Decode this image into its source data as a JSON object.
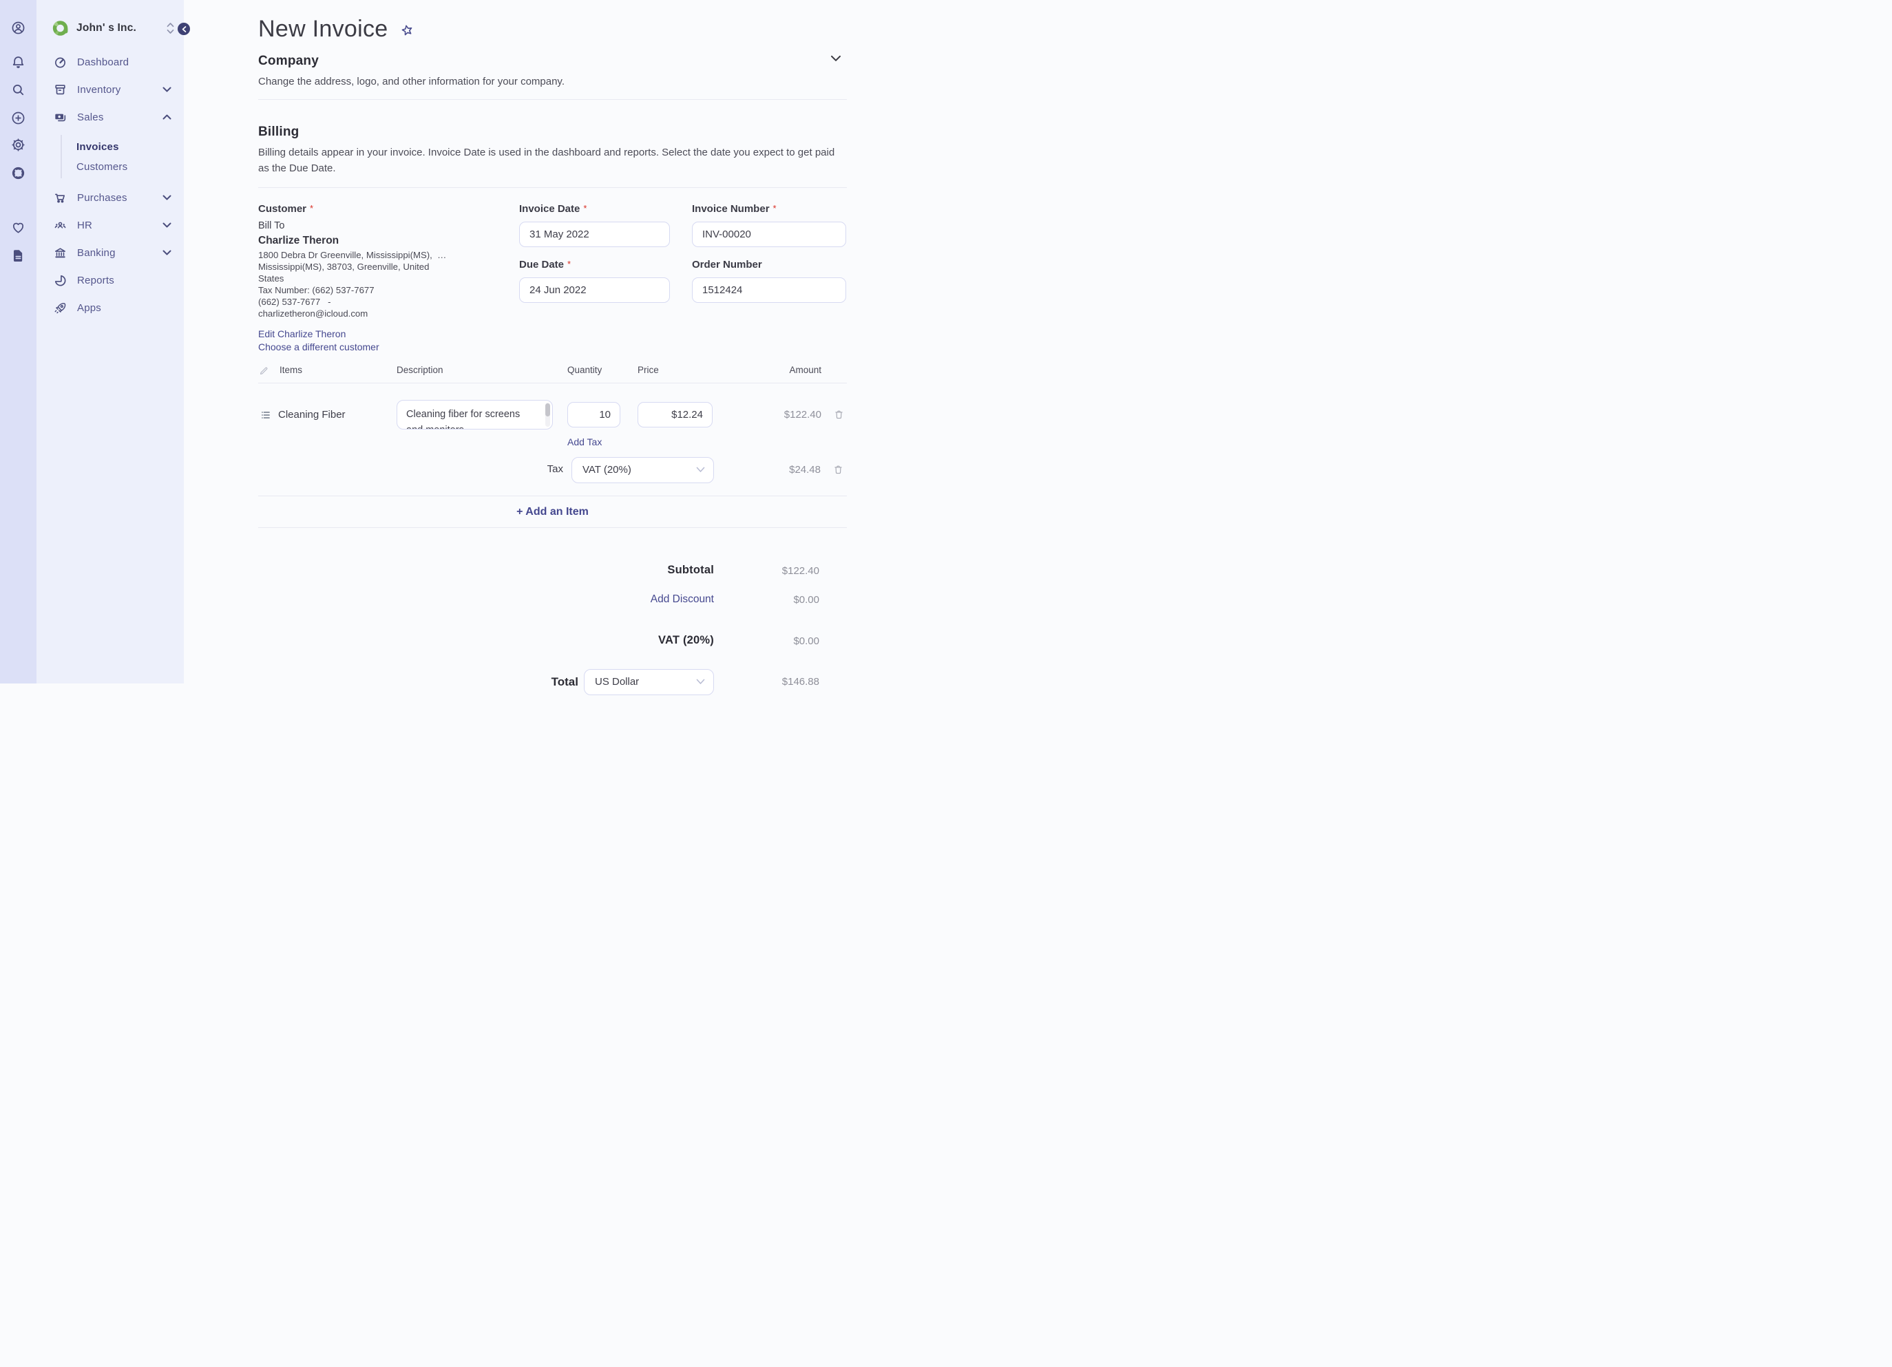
{
  "brand": {
    "company_name": "John' s Inc."
  },
  "icons": {
    "rail": [
      "user-circle",
      "bell",
      "search",
      "plus-circle",
      "gear",
      "life-ring",
      "heart",
      "document"
    ],
    "sidebar": [
      "dashboard-gauge",
      "inventory-box",
      "sales-wallet",
      "purchases-cart",
      "hr-people",
      "banking-bank",
      "reports-pie",
      "apps-rocket"
    ],
    "misc": [
      "company-logo",
      "company-switcher",
      "collapse-left",
      "star",
      "chevron-down",
      "chevron-up",
      "pencil",
      "drag-list",
      "trash",
      "scrollbar-thumb"
    ]
  },
  "sidebar": {
    "items": [
      {
        "label": "Dashboard",
        "chevron": ""
      },
      {
        "label": "Inventory",
        "chevron": "down"
      },
      {
        "label": "Sales",
        "chevron": "up"
      },
      {
        "label": "Purchases",
        "chevron": "down"
      },
      {
        "label": "HR",
        "chevron": "down"
      },
      {
        "label": "Banking",
        "chevron": "down"
      },
      {
        "label": "Reports",
        "chevron": ""
      },
      {
        "label": "Apps",
        "chevron": ""
      }
    ],
    "submenu": [
      "Invoices",
      "Customers"
    ],
    "submenu_active": "Invoices"
  },
  "page": {
    "title": "New Invoice"
  },
  "company_section": {
    "title": "Company",
    "description": "Change the address, logo, and other information for your company."
  },
  "billing_section": {
    "title": "Billing",
    "description": "Billing details appear in your invoice. Invoice Date is used in the dashboard and reports. Select the date you expect to get paid as the Due Date."
  },
  "customer": {
    "label": "Customer",
    "required_mark": "*",
    "bill_to": "Bill To",
    "name": "Charlize Theron",
    "address_line1": "1800 Debra Dr Greenville, Mississippi(MS),  …",
    "address_rest": "Mississippi(MS), 38703, Greenville, United States",
    "tax_number": "Tax Number: (662) 537-7677",
    "phone": "(662) 537-7677   -",
    "email": "charlizetheron@icloud.com",
    "edit_link": "Edit Charlize Theron",
    "choose_link": "Choose a different customer"
  },
  "fields": {
    "required_mark": "*",
    "invoice_date": {
      "label": "Invoice Date",
      "value": "31 May 2022"
    },
    "invoice_number": {
      "label": "Invoice Number",
      "value": "INV-00020"
    },
    "due_date": {
      "label": "Due Date",
      "value": "24 Jun 2022"
    },
    "order_number": {
      "label": "Order Number",
      "value": "1512424"
    }
  },
  "items_table": {
    "headers": {
      "items": "Items",
      "description": "Description",
      "quantity": "Quantity",
      "price": "Price",
      "amount": "Amount"
    },
    "rows": [
      {
        "name": "Cleaning Fiber",
        "description": "Cleaning fiber for screens and monitors",
        "quantity": "10",
        "price": "$12.24",
        "amount": "$122.40"
      }
    ],
    "add_tax_label": "Add Tax",
    "tax_label": "Tax",
    "tax_value": "VAT (20%)",
    "tax_amount": "$24.48",
    "add_item_label": "+ Add an Item"
  },
  "totals": {
    "subtotal_label": "Subtotal",
    "subtotal_value": "$122.40",
    "discount_label": "Add Discount",
    "discount_value": "$0.00",
    "vat_label": "VAT (20%)",
    "vat_value": "$0.00",
    "total_label": "Total",
    "currency_value": "US Dollar",
    "total_value": "$146.88"
  },
  "colors": {
    "rail_bg": "#dce0f7",
    "sidebar_bg": "#edf0fb",
    "main_bg": "#fafbfd",
    "accent_indigo": "#45488f",
    "nav_indigo": "#54568c",
    "logo_green": "#6fae4e",
    "required_red": "#d93025",
    "muted_amount": "#8f909b",
    "input_border": "#d7daf2"
  }
}
